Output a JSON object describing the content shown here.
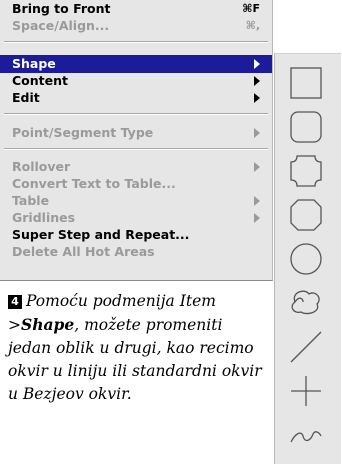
{
  "menu": {
    "items": [
      {
        "label": "Bring to Front",
        "shortcut": "⌘F",
        "disabled": false,
        "submenu": false
      },
      {
        "label": "Space/Align...",
        "shortcut": "⌘,",
        "disabled": true,
        "submenu": false
      },
      {
        "label": "Shape",
        "disabled": false,
        "submenu": true,
        "highlighted": true
      },
      {
        "label": "Content",
        "disabled": false,
        "submenu": true
      },
      {
        "label": "Edit",
        "disabled": false,
        "submenu": true
      },
      {
        "label": "Point/Segment Type",
        "disabled": true,
        "submenu": true
      },
      {
        "label": "Rollover",
        "disabled": true,
        "submenu": true
      },
      {
        "label": "Convert Text to Table...",
        "disabled": true,
        "submenu": false
      },
      {
        "label": "Table",
        "disabled": true,
        "submenu": true
      },
      {
        "label": "Gridlines",
        "disabled": true,
        "submenu": true
      },
      {
        "label": "Super Step and Repeat...",
        "disabled": false,
        "submenu": false
      },
      {
        "label": "Delete All Hot Areas",
        "disabled": true,
        "submenu": false
      }
    ]
  },
  "shape_submenu": {
    "checkmark": "✓",
    "shapes": [
      {
        "name": "rectangle-icon",
        "checked": true
      },
      {
        "name": "rounded-rectangle-icon"
      },
      {
        "name": "concave-rectangle-icon"
      },
      {
        "name": "beveled-rectangle-icon"
      },
      {
        "name": "oval-icon"
      },
      {
        "name": "freehand-shape-icon"
      },
      {
        "name": "line-icon"
      },
      {
        "name": "orthogonal-line-icon"
      },
      {
        "name": "bezier-line-icon"
      }
    ]
  },
  "caption": {
    "step": "4",
    "text_before": "Pomoću podmenija Item >",
    "text_bold": "Shape",
    "text_after": ", možete promeniti jedan oblik u drugi, kao recimo okvir u liniju ili standardni okvir u Bezjeov okvir."
  }
}
